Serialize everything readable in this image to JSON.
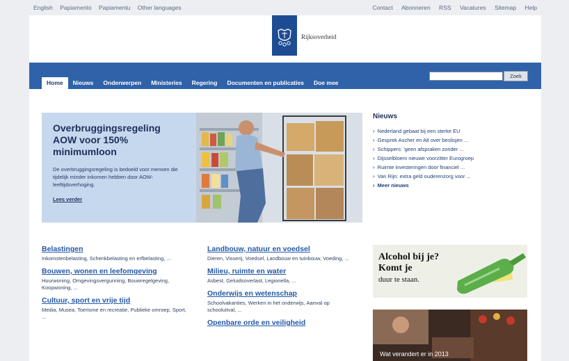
{
  "top_links_left": [
    "English",
    "Papiamento",
    "Papiamentu",
    "Other languages"
  ],
  "top_links_right": [
    "Contact",
    "Abonneren",
    "RSS",
    "Vacatures",
    "Sitemap",
    "Help"
  ],
  "logo": {
    "text": "Rijksoverheid"
  },
  "nav": {
    "tabs": [
      "Home",
      "Nieuws",
      "Onderwerpen",
      "Ministeries",
      "Regering",
      "Documenten en publicaties",
      "Doe mee"
    ],
    "active_index": 0
  },
  "search": {
    "button_label": "Zoek",
    "value": ""
  },
  "feature": {
    "title": "Overbruggingsregeling AOW voor 150% minimumloon",
    "text": "De overbruggingsregeling is bedoeld voor mensen die tijdelijk minder inkomen hebben door AOW-leeftijdsverhoging.",
    "link": "Lees verder"
  },
  "news": {
    "title": "Nieuws",
    "items": [
      "Nederland gebaat bij een sterke EU",
      "Gesprek Ascher en Alt over beslisjen ...",
      "Schippers: 'geen afspraken zonder ...",
      "Dijsselbloem nieuwe voorzitter Eurogroep",
      "Ruimte investeringen door financiel ...",
      "Van Rijn: extra geld ouderenzorg voor ..."
    ],
    "more": "Meer nieuws"
  },
  "topics_col1": [
    {
      "title": "Belastingen",
      "desc": "Inkomstenbelasting, Schenkbelasting en erfbelasting, ..."
    },
    {
      "title": "Bouwen, wonen en leefomgeving",
      "desc": "Huurwoning, Omgevingsvergunning, Bouwregelgeving, Koopwoning, ..."
    },
    {
      "title": "Cultuur, sport en vrije tijd",
      "desc": "Media, Musea, Toerisme en recreatie, Publieke omroep, Sport, ..."
    }
  ],
  "topics_col2": [
    {
      "title": "Landbouw, natuur en voedsel",
      "desc": "Dieren, Visserij, Voedsel, Landbouw en tuinbouw, Voeding, ..."
    },
    {
      "title": "Milieu, ruimte en water",
      "desc": "Asbest, Geluidsoverlast, Legionella, ..."
    },
    {
      "title": "Onderwijs en wetenschap",
      "desc": "Schoolvakanties, Werken in het onderwijs, Aanval op schooluitval, ..."
    },
    {
      "title": "Openbare orde en veiligheid",
      "desc": ""
    }
  ],
  "ad1": {
    "line1": "Alcohol bij je?",
    "line2": "Komt je",
    "line3": "duur te staan."
  },
  "ad2": {
    "text": "Wat verandert er in 2013"
  },
  "colors": {
    "nav_blue": "#2f62a9",
    "logo_blue": "#1e4c93",
    "link_blue": "#2458a8",
    "feature_bg": "#c6d8ee"
  }
}
